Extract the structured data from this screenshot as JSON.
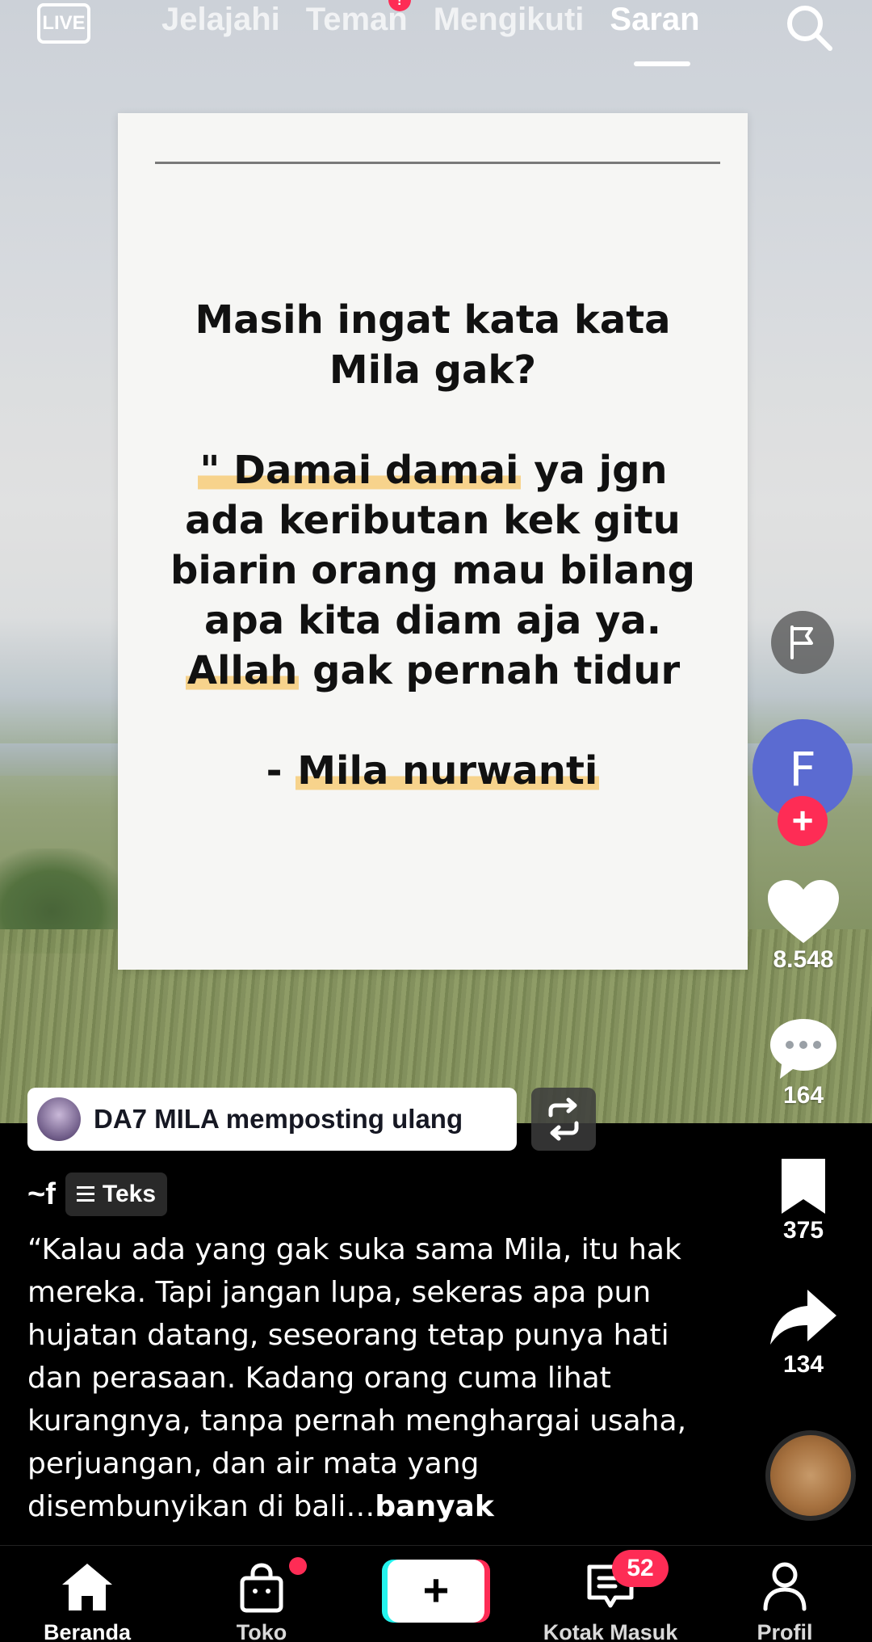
{
  "top_nav": {
    "live_label": "LIVE",
    "tabs": [
      {
        "label": "Jelajahi",
        "active": false
      },
      {
        "label": "Teman",
        "active": false,
        "has_notification": true
      },
      {
        "label": "Mengikuti",
        "active": false
      },
      {
        "label": "Saran",
        "active": true
      }
    ],
    "search_icon": "search-icon"
  },
  "post_card": {
    "quote_lines": [
      "Masih ingat kata kata",
      "Mila gak?",
      "",
      "\" Damai damai ya jgn",
      "ada keributan kek gitu",
      "biarin orang mau bilang",
      "apa kita diam aja ya.",
      "Allah gak pernah tidur",
      "",
      "- Mila nurwanti"
    ],
    "highlight_color": "#f7d38c"
  },
  "actions": {
    "report_icon": "flag-icon",
    "creator_avatar_letter": "F",
    "follow_icon": "plus-icon",
    "likes": "8.548",
    "comments": "164",
    "bookmarks": "375",
    "shares": "134"
  },
  "repost": {
    "text": "DA7 MILA memposting ulang"
  },
  "caption": {
    "author": "~f",
    "type_badge": "Teks",
    "text": "“Kalau ada yang gak suka sama Mila, itu hak mereka. Tapi jangan lupa, sekeras apa pun hujatan datang, seseorang tetap punya hati dan perasaan. Kadang orang cuma lihat kurangnya, tanpa pernah menghargai usaha, perjuangan, dan air mata yang disembunyikan di bali…",
    "more_label": "banyak"
  },
  "bottom_nav": {
    "items": [
      {
        "label": "Beranda",
        "icon": "home-icon",
        "active": true
      },
      {
        "label": "Toko",
        "icon": "shop-bag-icon",
        "active": false
      },
      {
        "label": "",
        "icon": "create-plus-icon",
        "active": false
      },
      {
        "label": "Kotak Masuk",
        "icon": "inbox-icon",
        "active": false,
        "badge": "52"
      },
      {
        "label": "Profil",
        "icon": "profile-icon",
        "active": false
      }
    ]
  },
  "colors": {
    "accent": "#fe2c55",
    "accent_cyan": "#25f4ee",
    "avatar_blue": "#5b6bd1"
  }
}
